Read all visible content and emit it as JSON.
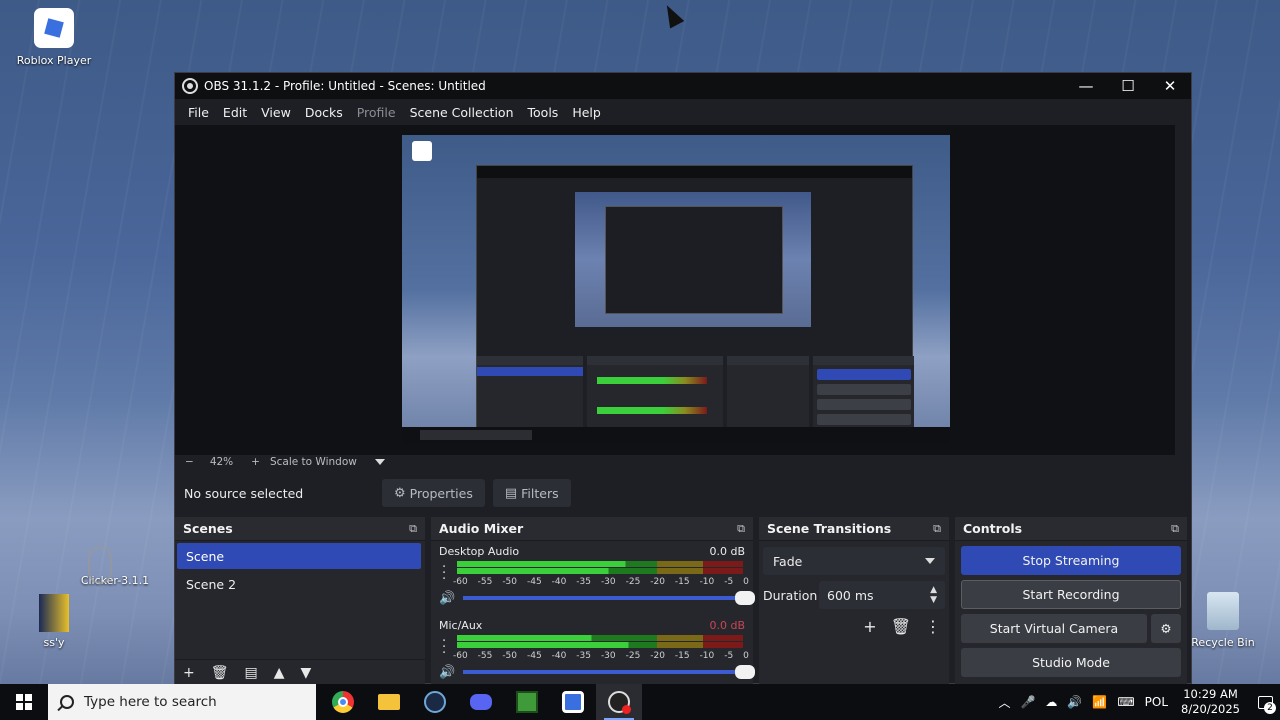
{
  "desktop": {
    "icons": [
      {
        "label": "Roblox Player"
      },
      {
        "label": "Clicker-3.1.1"
      },
      {
        "label": "ss'y"
      },
      {
        "label": "Recycle Bin"
      }
    ]
  },
  "window": {
    "title": "OBS 31.1.2 - Profile: Untitled - Scenes: Untitled",
    "minimize": "—",
    "maximize": "☐",
    "close": "✕"
  },
  "menu": [
    "File",
    "Edit",
    "View",
    "Docks",
    "Profile",
    "Scene Collection",
    "Tools",
    "Help"
  ],
  "zoom": {
    "minus": "−",
    "level": "42%",
    "plus": "+",
    "mode": "Scale to Window"
  },
  "source_bar": {
    "status": "No source selected",
    "properties": "Properties",
    "filters": "Filters"
  },
  "scenes": {
    "title": "Scenes",
    "items": [
      {
        "label": "Scene",
        "active": true
      },
      {
        "label": "Scene 2",
        "active": false
      }
    ]
  },
  "mixer": {
    "title": "Audio Mixer",
    "channels": [
      {
        "name": "Desktop Audio",
        "db": "0.0 dB"
      },
      {
        "name": "Mic/Aux",
        "db": "0.0 dB"
      }
    ],
    "ticks": [
      "-60",
      "-55",
      "-50",
      "-45",
      "-40",
      "-35",
      "-30",
      "-25",
      "-20",
      "-15",
      "-10",
      "-5",
      "0"
    ]
  },
  "transitions": {
    "title": "Scene Transitions",
    "selected": "Fade",
    "duration_label": "Duration",
    "duration_value": "600 ms"
  },
  "controls": {
    "title": "Controls",
    "stop_streaming": "Stop Streaming",
    "start_recording": "Start Recording",
    "start_virtual_camera": "Start Virtual Camera",
    "studio_mode": "Studio Mode"
  },
  "taskbar": {
    "search_placeholder": "Type here to search",
    "language": "POL",
    "time": "10:29 AM",
    "date": "8/20/2025",
    "notifications": "2"
  },
  "colors": {
    "accent": "#2f4ab4",
    "meter_green": "#3bd03b",
    "meter_red": "#7c1a1a"
  }
}
